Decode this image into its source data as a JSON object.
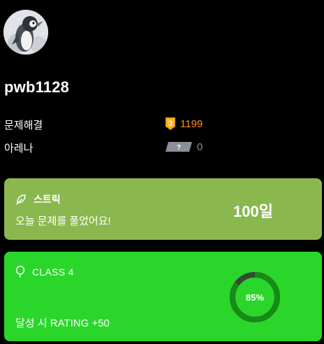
{
  "profile": {
    "username": "pwb1128",
    "avatar_icon": "penguin-avatar"
  },
  "stats": {
    "solved_label": "문제해결",
    "solved_tier": "3",
    "solved_count": "1199",
    "arena_label": "아레나",
    "arena_tier": "?",
    "arena_count": "0"
  },
  "streak": {
    "icon": "leaf-icon",
    "title": "스트릭",
    "message": "오늘 문제를 풀었어요!",
    "days": "100일",
    "color": "#8bb84e"
  },
  "class_card": {
    "icon": "balloon-icon",
    "title": "CLASS 4",
    "subtitle": "달성 시 RATING +50",
    "progress": 0.85,
    "progress_label": "85%",
    "color": "#2bd62b"
  },
  "colors": {
    "solved_accent": "#ff8c21",
    "arena_muted": "#8a8f98"
  }
}
